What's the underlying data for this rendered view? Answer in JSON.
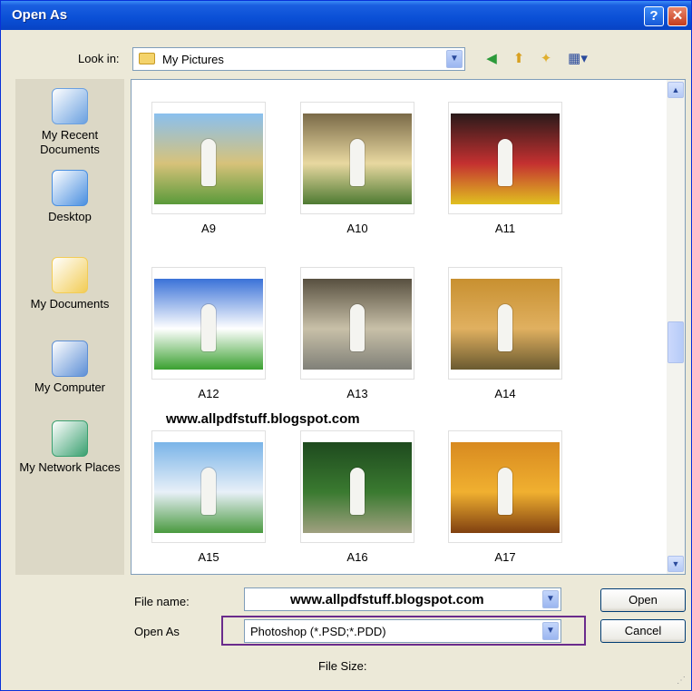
{
  "window": {
    "title": "Open As",
    "help_glyph": "?",
    "close_glyph": "✕"
  },
  "lookin": {
    "label": "Look in:",
    "value": "My Pictures",
    "arrow_icon": "chevron-down-icon"
  },
  "toolbar": {
    "back_glyph": "◀",
    "up_glyph": "⬆",
    "new_folder_glyph": "✦",
    "views_glyph": "▦▾"
  },
  "places": [
    {
      "label": "My Recent Documents",
      "icon": "recent-documents-icon",
      "color": "#6aa0e0"
    },
    {
      "label": "Desktop",
      "icon": "desktop-icon",
      "color": "#4a8fe0"
    },
    {
      "label": "My Documents",
      "icon": "my-documents-icon",
      "color": "#f2cc55"
    },
    {
      "label": "My Computer",
      "icon": "my-computer-icon",
      "color": "#5d8fd6"
    },
    {
      "label": "My Network Places",
      "icon": "network-places-icon",
      "color": "#3aa070"
    }
  ],
  "files": [
    {
      "name": "A9",
      "colors": [
        "#8ac0ee",
        "#d7c27a",
        "#5a9a3a"
      ]
    },
    {
      "name": "A10",
      "colors": [
        "#7a6a48",
        "#e8d8a0",
        "#4e7a32"
      ]
    },
    {
      "name": "A11",
      "colors": [
        "#2a1a1a",
        "#c43030",
        "#e0c020"
      ]
    },
    {
      "name": "A12",
      "colors": [
        "#3a72d8",
        "#ffffff",
        "#3aa030"
      ]
    },
    {
      "name": "A13",
      "colors": [
        "#585040",
        "#c8c0a8",
        "#808078"
      ]
    },
    {
      "name": "A14",
      "colors": [
        "#c89030",
        "#e0b060",
        "#6a5a30"
      ]
    },
    {
      "name": "A15",
      "colors": [
        "#7ab4e8",
        "#e8f0f8",
        "#4a9a40"
      ]
    },
    {
      "name": "A16",
      "colors": [
        "#1e4a1e",
        "#3a7a30",
        "#a0a080"
      ]
    },
    {
      "name": "A17",
      "colors": [
        "#d88a20",
        "#f0b030",
        "#804010"
      ]
    }
  ],
  "watermark_text": "www.allpdfstuff.blogspot.com",
  "filename": {
    "label": "File name:",
    "value": "www.allpdfstuff.blogspot.com"
  },
  "openas": {
    "label": "Open As",
    "value": "Photoshop (*.PSD;*.PDD)"
  },
  "buttons": {
    "open": "Open",
    "cancel": "Cancel"
  },
  "filesize_label": "File Size:"
}
